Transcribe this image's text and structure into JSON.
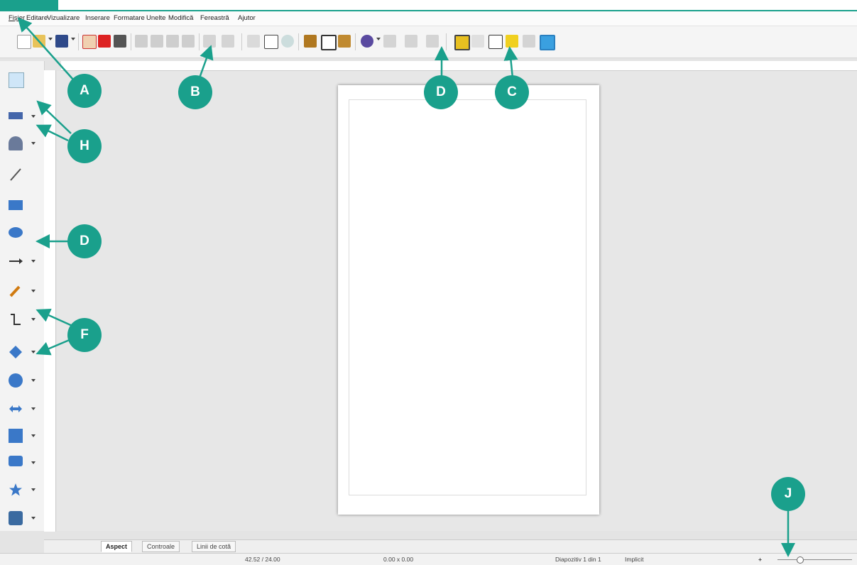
{
  "menu": {
    "items": [
      "Fișier",
      "Editare",
      "Vizualizare",
      "Inserare",
      "Formatare",
      "Unelte",
      "Modifică",
      "Fereastră",
      "Ajutor"
    ]
  },
  "toolbar": {
    "icons": [
      "new-icon",
      "open-icon",
      "save-icon",
      "export-icon",
      "pdf-icon",
      "print-icon",
      "cut-icon",
      "copy-icon",
      "paste-icon",
      "clone-icon",
      "undo-icon",
      "redo-icon",
      "grid-icon",
      "helplines-icon",
      "zoom-icon",
      "image-icon",
      "textbox-icon",
      "fontwork-icon",
      "rotate-icon",
      "align-icon",
      "arrange-icon",
      "distribute-icon",
      "shadow-icon",
      "crop-icon",
      "points-icon",
      "glue-icon",
      "3d-icon",
      "toggle-extrusion-icon"
    ]
  },
  "left_toolbar": {
    "icons": [
      "select-icon",
      "line-color-icon",
      "fill-color-icon",
      "line-icon",
      "rectangle-icon",
      "ellipse-icon",
      "arrow-line-icon",
      "curve-icon",
      "connector-icon",
      "basic-shapes-icon",
      "symbol-shapes-icon",
      "block-arrows-icon",
      "flowchart-icon",
      "callouts-icon",
      "stars-icon",
      "3d-objects-icon"
    ]
  },
  "tabs": [
    "Aspect",
    "Controale",
    "Linii de cotă"
  ],
  "status": {
    "position": "42.52 / 24.00",
    "size": "0.00 x 0.00",
    "slide": "Diapozitiv 1 din 1",
    "layout": "Implicit"
  },
  "callouts": {
    "a": "A",
    "b": "B",
    "c": "C",
    "d_top": "D",
    "d_left": "D",
    "h": "H",
    "f": "F",
    "j": "J"
  },
  "colors": {
    "accent": "#1aa08c",
    "page": "#ffffff",
    "canvas": "#e7e7e7"
  }
}
